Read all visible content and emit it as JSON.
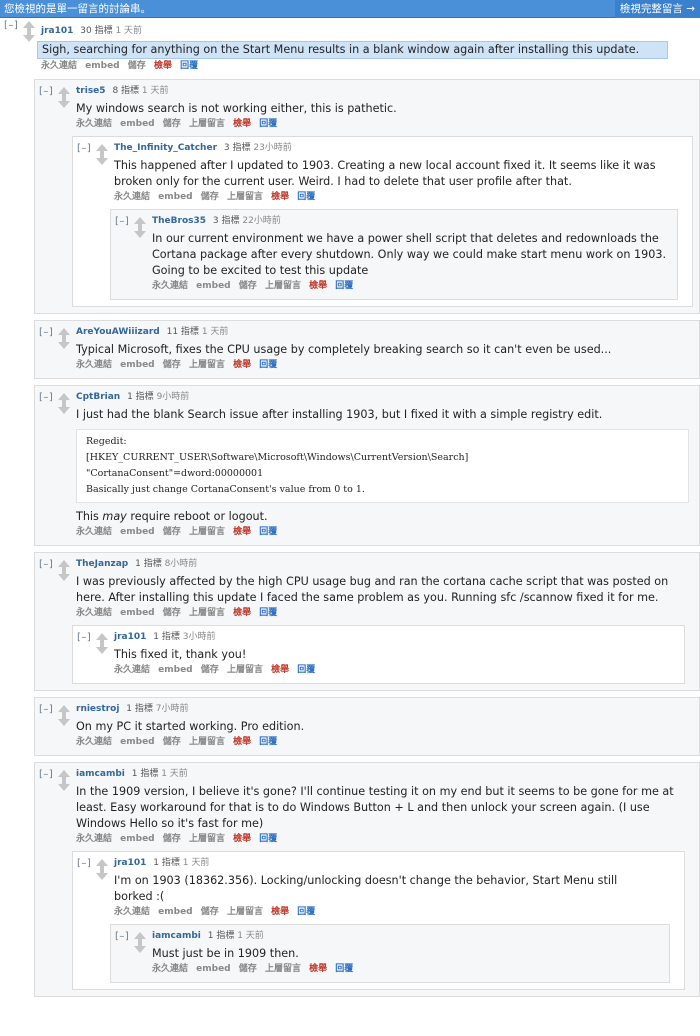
{
  "topbar": {
    "notice": "您檢視的是單一留言的討論串。",
    "view_all": "檢視完整留言 →"
  },
  "actions": {
    "toggle": "[–]",
    "permalink": "永久連結",
    "embed": "embed",
    "save": "儲存",
    "parent": "上層留言",
    "report": "檢舉",
    "reply": "回覆"
  },
  "c0": {
    "author": "jra101",
    "points": "30 指標",
    "time": "1 天前",
    "body": "Sigh, searching for anything on the Start Menu results in a blank window again after installing this update."
  },
  "c1": {
    "author": "trise5",
    "points": "8 指標",
    "time": "1 天前",
    "body": "My windows search is not working either, this is pathetic."
  },
  "c2": {
    "author": "The_Infinity_Catcher",
    "points": "3 指標",
    "time": "23小時前",
    "body": "This happened after I updated to 1903. Creating a new local account fixed it. It seems like it was broken only for the current user. Weird. I had to delete that user profile after that."
  },
  "c3": {
    "author": "TheBros35",
    "points": "3 指標",
    "time": "22小時前",
    "body": "In our current environment we have a power shell script that deletes and redownloads the Cortana package after every shutdown. Only way we could make start menu work on 1903. Going to be excited to test this update"
  },
  "c4": {
    "author": "AreYouAWiiizard",
    "points": "11 指標",
    "time": "1 天前",
    "body": "Typical Microsoft, fixes the CPU usage by completely breaking search so it can't even be used..."
  },
  "c5": {
    "author": "CptBrian",
    "points": "1 指標",
    "time": "9小時前",
    "body": "I just had the blank Search issue after installing 1903, but I fixed it with a simple registry edit.",
    "code": [
      "Regedit:",
      "[HKEY_CURRENT_USER\\Software\\Microsoft\\Windows\\CurrentVersion\\Search]",
      "\"CortanaConsent\"=dword:00000001",
      "Basically just change CortanaConsent's value from 0 to 1."
    ],
    "note_pre": "This ",
    "note_em": "may",
    "note_post": " require reboot or logout."
  },
  "c6": {
    "author": "TheJanzap",
    "points": "1 指標",
    "time": "8小時前",
    "body": "I was previously affected by the high CPU usage bug and ran the cortana cache script that was posted on here. After installing this update I faced the same problem as you. Running sfc /scannow fixed it for me."
  },
  "c7": {
    "author": "jra101",
    "points": "1 指標",
    "time": "3小時前",
    "body": "This fixed it, thank you!"
  },
  "c8": {
    "author": "rniestroj",
    "points": "1 指標",
    "time": "7小時前",
    "body": "On my PC it started working. Pro edition."
  },
  "c9": {
    "author": "iamcambi",
    "points": "1 指標",
    "time": "1 天前",
    "body": "In the 1909 version, I believe it's gone? I'll continue testing it on my end but it seems to be gone for me at least. Easy workaround for that is to do Windows Button + L and then unlock your screen again. (I use Windows Hello so it's fast for me)"
  },
  "c10": {
    "author": "jra101",
    "points": "1 指標",
    "time": "1 天前",
    "body": "I'm on 1903 (18362.356). Locking/unlocking doesn't change the behavior, Start Menu still borked :("
  },
  "c11": {
    "author": "iamcambi",
    "points": "1 指標",
    "time": "1 天前",
    "body": "Must just be in 1909 then."
  }
}
